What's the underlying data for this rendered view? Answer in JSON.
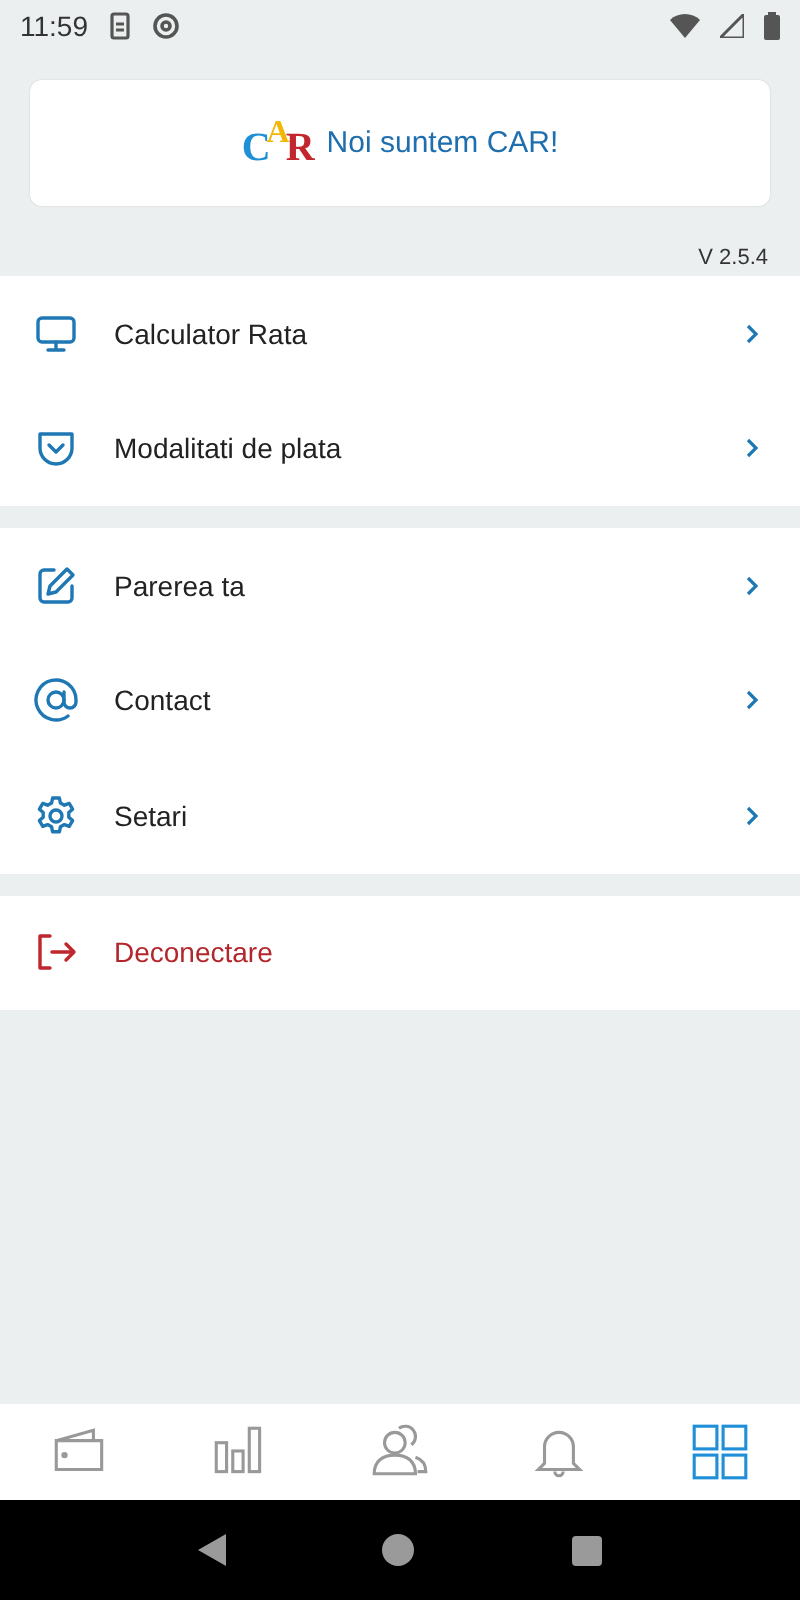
{
  "status_bar": {
    "time": "11:59"
  },
  "banner": {
    "logo": "CAR",
    "text": "Noi suntem CAR!"
  },
  "version": "V 2.5.4",
  "menu_groups": [
    {
      "items": [
        {
          "label": "Calculator Rata",
          "kind": "link"
        },
        {
          "label": "Modalitati de plata",
          "kind": "link"
        }
      ]
    },
    {
      "items": [
        {
          "label": "Parerea ta",
          "kind": "link"
        },
        {
          "label": "Contact",
          "kind": "link"
        },
        {
          "label": "Setari",
          "kind": "link"
        }
      ]
    },
    {
      "items": [
        {
          "label": "Deconectare",
          "kind": "logout"
        }
      ]
    }
  ],
  "bottom_nav": [
    {
      "selected": false
    },
    {
      "selected": false
    },
    {
      "selected": false
    },
    {
      "selected": false
    },
    {
      "selected": true
    }
  ]
}
